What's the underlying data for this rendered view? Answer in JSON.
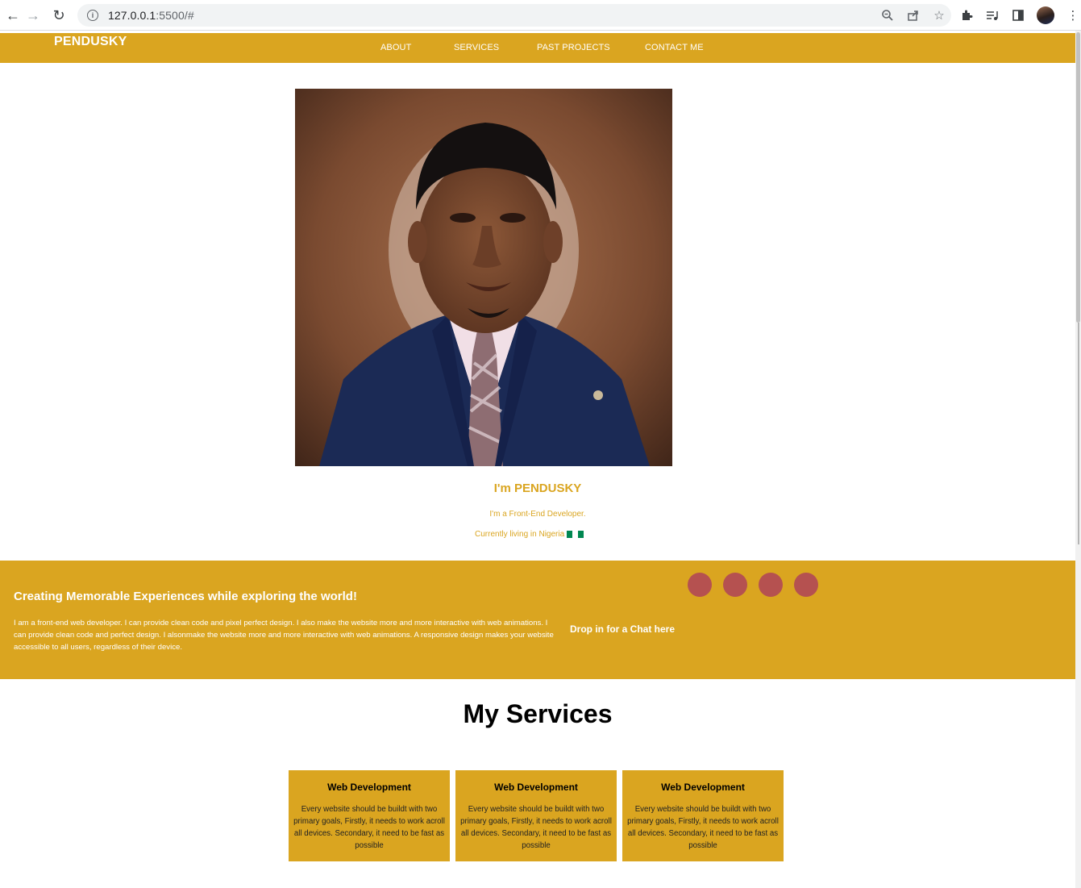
{
  "browser": {
    "url_host": "127.0.0.1",
    "url_rest": ":5500/#",
    "icons": [
      "back-icon",
      "forward-icon",
      "reload-icon",
      "site-info-icon",
      "zoom-icon",
      "share-icon",
      "bookmark-star-icon",
      "extensions-icon",
      "media-icon",
      "side-panel-icon",
      "profile-avatar",
      "menu-icon"
    ]
  },
  "header": {
    "logo": "PENDUSKY",
    "nav": [
      {
        "label": "ABOUT"
      },
      {
        "label": "SERVICES"
      },
      {
        "label": "PAST PROJECTS"
      },
      {
        "label": "CONTACT ME"
      }
    ]
  },
  "hero": {
    "name": "I'm PENDUSKY",
    "role": "I'm a Front-End Developer.",
    "location": "Currently living in Nigeria"
  },
  "banner": {
    "title": "Creating Memorable Experiences while exploring the world!",
    "text": "I am a front-end web developer. I can provide clean code and pixel perfect design. I also make the website more and more interactive with web animations. I can provide clean code and perfect design. I alsonmake the website more and more interactive with web animations. A responsive design makes your website accessible to all users, regardless of their device.",
    "chat_link": "Drop in for a Chat here"
  },
  "services": {
    "title": "My Services",
    "cards": [
      {
        "title": "Web Development",
        "text": "Every website should be buildt with two primary goals, Firstly, it needs to work acroll all devices. Secondary, it need to be fast as possible"
      },
      {
        "title": "Web Development",
        "text": "Every website should be buildt with two primary goals, Firstly, it needs to work acroll all devices. Secondary, it need to be fast as possible"
      },
      {
        "title": "Web Development",
        "text": "Every website should be buildt with two primary goals, Firstly, it needs to work acroll all devices. Secondary, it need to be fast as possible"
      }
    ]
  },
  "colors": {
    "accent": "#daa520",
    "social_circle": "#b55150",
    "flag_green": "#008751",
    "flag_white": "#ffffff"
  }
}
